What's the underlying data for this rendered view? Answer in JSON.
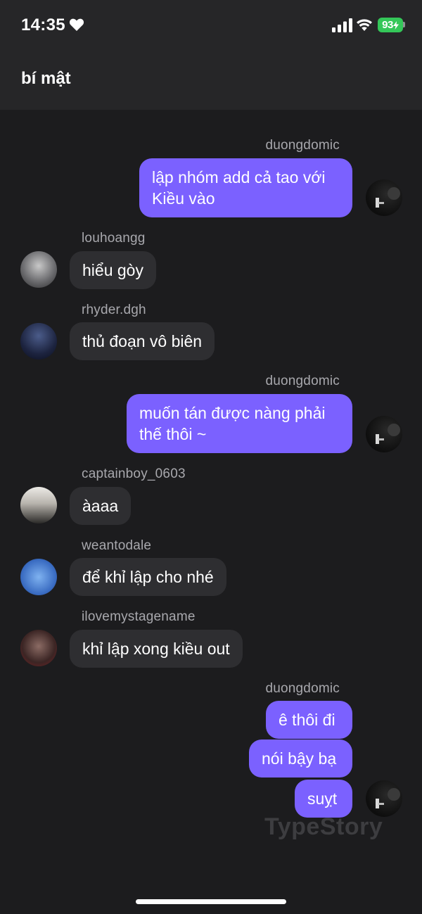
{
  "status_bar": {
    "time": "14:35",
    "battery": "93",
    "icons": [
      "heart-icon",
      "signal-icon",
      "wifi-icon",
      "battery-icon"
    ],
    "battery_color": "#34c759"
  },
  "chat": {
    "title": "bí mật"
  },
  "colors": {
    "outgoing_bubble": "#7b61ff",
    "incoming_bubble": "#2e2e31",
    "background": "#1c1c1e",
    "header": "#262628"
  },
  "messages": [
    {
      "sender": "duongdomic",
      "direction": "out",
      "text": "lập nhóm add cả tao với\nKiều vào"
    },
    {
      "sender": "louhoangg",
      "direction": "in",
      "text": "hiểu gòy"
    },
    {
      "sender": "rhyder.dgh",
      "direction": "in",
      "text": "thủ đoạn vô biên"
    },
    {
      "sender": "duongdomic",
      "direction": "out",
      "text": "muốn tán được nàng phải\nthế thôi ~"
    },
    {
      "sender": "captainboy_0603",
      "direction": "in",
      "text": "àaaa"
    },
    {
      "sender": "weantodale",
      "direction": "in",
      "text": "để khỉ lập cho nhé"
    },
    {
      "sender": "ilovemystagename",
      "direction": "in",
      "text": "khỉ lập xong kiều out"
    },
    {
      "sender": "duongdomic",
      "direction": "out",
      "text": "ê thôi đi"
    },
    {
      "sender": "duongdomic",
      "direction": "out",
      "text": "nói bậy bạ"
    },
    {
      "sender": "duongdomic",
      "direction": "out",
      "text": "suỵt"
    }
  ],
  "watermark": "TypeStory"
}
